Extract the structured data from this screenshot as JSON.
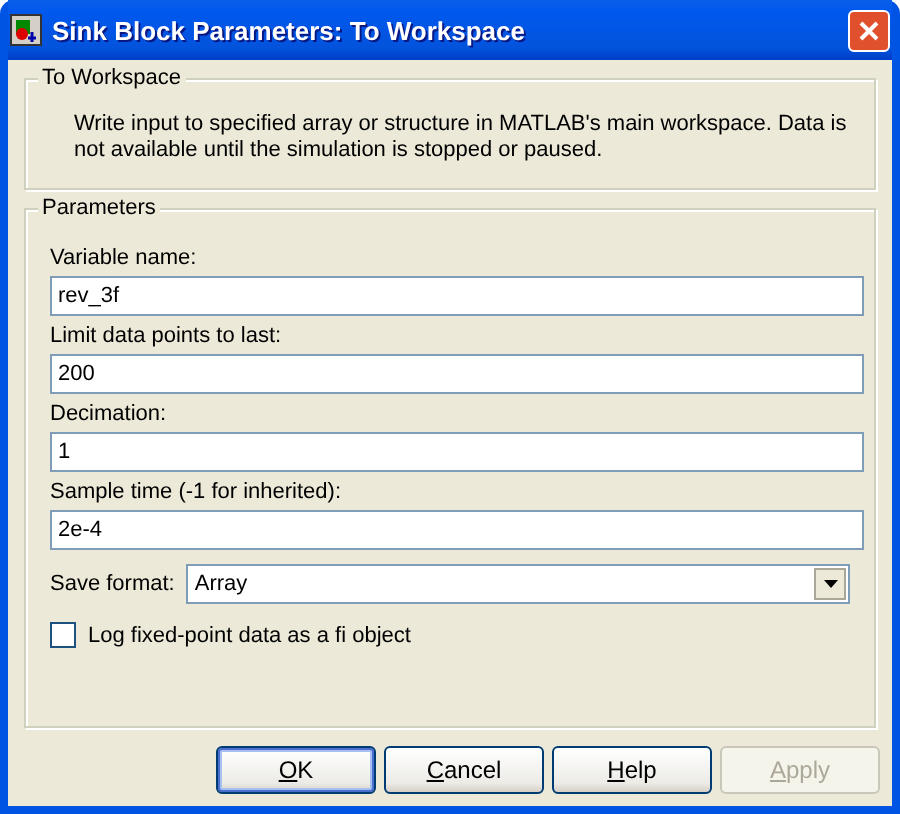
{
  "window": {
    "title": "Sink Block Parameters: To Workspace"
  },
  "description": {
    "title": "To Workspace",
    "text": "Write input to specified array or structure in MATLAB's main workspace. Data is not available until the simulation is stopped or paused."
  },
  "parameters": {
    "title": "Parameters",
    "fields": [
      {
        "label": "Variable name:",
        "value": "rev_3f"
      },
      {
        "label": "Limit data points to last:",
        "value": "200"
      },
      {
        "label": "Decimation:",
        "value": "1"
      },
      {
        "label": "Sample time (-1 for inherited):",
        "value": "2e-4"
      }
    ],
    "save_format": {
      "label": "Save format:",
      "value": "Array"
    },
    "log_fixed_point": {
      "label": "Log fixed-point data as a fi object",
      "checked": false
    }
  },
  "buttons": [
    {
      "label": "OK",
      "default": true,
      "disabled": false
    },
    {
      "label": "Cancel",
      "default": false,
      "disabled": false
    },
    {
      "label": "Help",
      "default": false,
      "disabled": false
    },
    {
      "label": "Apply",
      "default": false,
      "disabled": true
    }
  ]
}
